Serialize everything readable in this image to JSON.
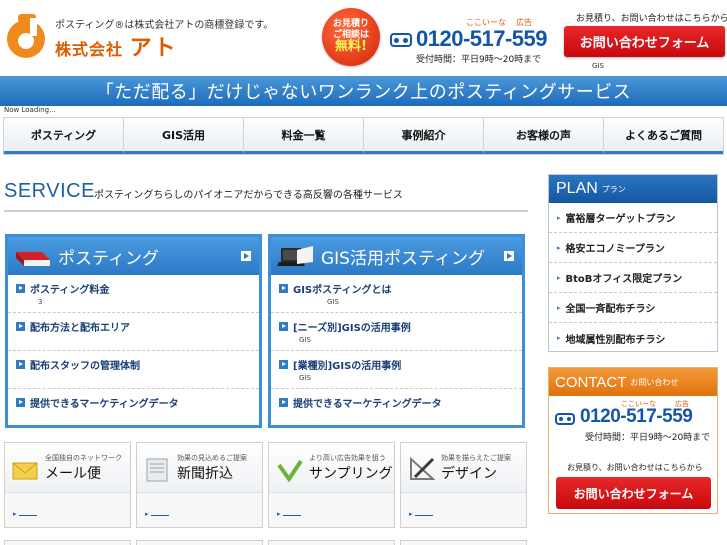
{
  "header": {
    "reg_note": "ポスティング®は株式会社アトの商標登録です。",
    "company_prefix": "株式会社",
    "company_name": "アト",
    "free_badge": {
      "line1": "お見積り",
      "line2": "ご相談は",
      "line3": "無料!"
    },
    "phone": {
      "kana": "ここいーな",
      "ad": "広告",
      "number": "0120-517-559",
      "hours": "受付時間：平日9時～20時まで"
    },
    "estimate_note": "お見積り、お問い合わせはこちらから",
    "contact_button": "お問い合わせフォーム",
    "gis_corner": "GIS"
  },
  "banner": "「ただ配る」だけじゃないワンランク上のポスティングサービス",
  "loading": "Now Loading...",
  "nav": {
    "items": [
      {
        "label": "ポスティング"
      },
      {
        "label": "GIS活用"
      },
      {
        "label": "料金一覧"
      },
      {
        "label": "事例紹介"
      },
      {
        "label": "お客様の声"
      },
      {
        "label": "よくあるご質問"
      }
    ]
  },
  "service": {
    "title": "SERVICE",
    "subtitle": "ポスティングちらしのパイオニアだからできる高反響の各種サービス"
  },
  "panels": {
    "posting": {
      "title": "ポスティング",
      "rows": [
        {
          "label": "ポスティング料金",
          "sub": "3"
        },
        {
          "label": "配布方法と配布エリア",
          "sub": ""
        },
        {
          "label": "配布スタッフの管理体制",
          "sub": ""
        },
        {
          "label": "提供できるマーケティングデータ",
          "sub": ""
        }
      ]
    },
    "gis": {
      "title": "GIS活用ポスティング",
      "rows": [
        {
          "label": "GISポスティングとは",
          "sub": "GIS"
        },
        {
          "label": "[ニーズ別]GISの活用事例",
          "sub": "GIS"
        },
        {
          "label": "[業種別]GISの活用事例",
          "sub": "GIS"
        },
        {
          "label": "提供できるマーケティングデータ",
          "sub": ""
        }
      ]
    }
  },
  "cards": [
    {
      "note": "全国独自のネットワーク",
      "title": "メール便"
    },
    {
      "note": "効果の見込めるご提案",
      "title": "新聞折込"
    },
    {
      "note": "より高い広告効果を狙う",
      "title": "サンプリング"
    },
    {
      "note": "効果を描らえたご提案",
      "title": "デザイン"
    }
  ],
  "plan": {
    "title": "PLAN",
    "title_small": "プラン",
    "items": [
      {
        "label": "富裕層ターゲットプラン"
      },
      {
        "label": "格安エコノミープラン"
      },
      {
        "label": "BtoBオフィス限定プラン"
      },
      {
        "label": "全国一斉配布チラシ"
      },
      {
        "label": "地域属性別配布チラシ"
      }
    ]
  },
  "contact": {
    "title": "CONTACT",
    "title_small": "お問い合わせ",
    "kana": "ここいーな",
    "ad": "広告",
    "number": "0120-517-559",
    "hours": "受付時間：平日9時～20時まで",
    "note": "お見積り、お問い合わせはこちらから",
    "button": "お問い合わせフォーム"
  },
  "colors": {
    "brand_orange": "#e25a00",
    "brand_blue": "#1e6cbb",
    "cta_red": "#d21416"
  }
}
